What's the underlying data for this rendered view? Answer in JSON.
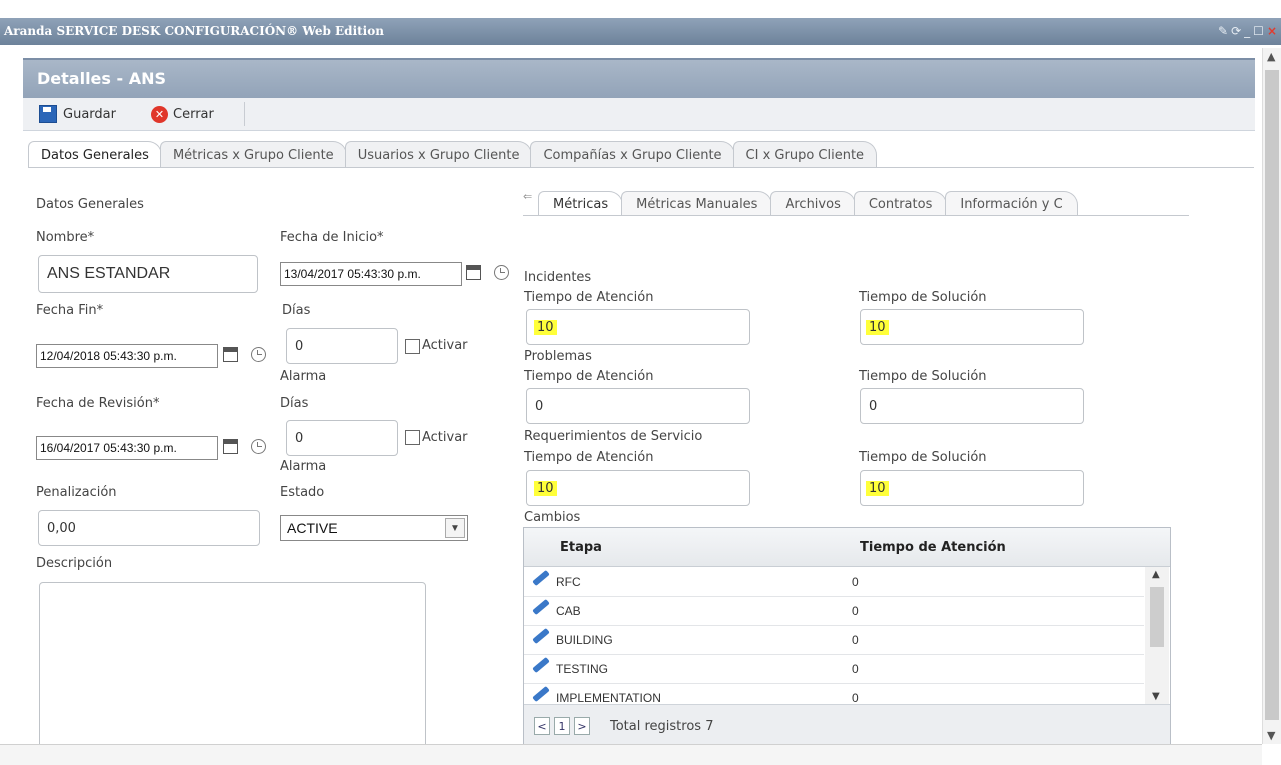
{
  "window": {
    "title": "Aranda SERVICE DESK CONFIGURACIÓN® Web Edition"
  },
  "header": {
    "title": "Detalles - ANS"
  },
  "toolbar": {
    "save_label": "Guardar",
    "close_label": "Cerrar"
  },
  "tabs": [
    "Datos Generales",
    "Métricas x Grupo Cliente",
    "Usuarios x Grupo Cliente",
    "Compañías x Grupo Cliente",
    "CI x Grupo Cliente"
  ],
  "left": {
    "section_title": "Datos Generales",
    "nombre_label": "Nombre*",
    "nombre_value": "ANS ESTANDAR",
    "fecha_inicio_label": "Fecha de Inicio*",
    "fecha_inicio_value": "13/04/2017 05:43:30 p.m.",
    "fecha_fin_label": "Fecha Fin*",
    "fecha_fin_value": "12/04/2018 05:43:30 p.m.",
    "dias_label": "Días",
    "dias1_value": "0",
    "activar_label": "Activar",
    "alarma_label": "Alarma",
    "fecha_revision_label": "Fecha de Revisión*",
    "fecha_revision_value": "16/04/2017 05:43:30 p.m.",
    "dias2_value": "0",
    "penalizacion_label": "Penalización",
    "penalizacion_value": "0,00",
    "estado_label": "Estado",
    "estado_value": "ACTIVE",
    "descripcion_label": "Descripción"
  },
  "right_tabs": [
    "Métricas",
    "Métricas Manuales",
    "Archivos",
    "Contratos",
    "Información y C"
  ],
  "metrics": {
    "atencion_label": "Tiempo de Atención",
    "solucion_label": "Tiempo de Solución",
    "incidentes": {
      "title": "Incidentes",
      "atencion": "10",
      "solucion": "10"
    },
    "problemas": {
      "title": "Problemas",
      "atencion": "0",
      "solucion": "0"
    },
    "requerimientos": {
      "title": "Requerimientos de Servicio",
      "atencion": "10",
      "solucion": "10"
    },
    "cambios_title": "Cambios"
  },
  "grid": {
    "headers": [
      "Etapa",
      "Tiempo de Atención"
    ],
    "rows": [
      {
        "etapa": "RFC",
        "tiempo": "0"
      },
      {
        "etapa": "CAB",
        "tiempo": "0"
      },
      {
        "etapa": "BUILDING",
        "tiempo": "0"
      },
      {
        "etapa": "TESTING",
        "tiempo": "0"
      },
      {
        "etapa": "IMPLEMENTATION",
        "tiempo": "0"
      }
    ],
    "pager": {
      "prev": "<",
      "page": "1",
      "next": ">",
      "total": "Total registros 7"
    }
  },
  "colors": {
    "highlight": "#ffff3a",
    "header_bg": "#a9b7c8",
    "titlebar_bg": "#7a8ea6"
  }
}
